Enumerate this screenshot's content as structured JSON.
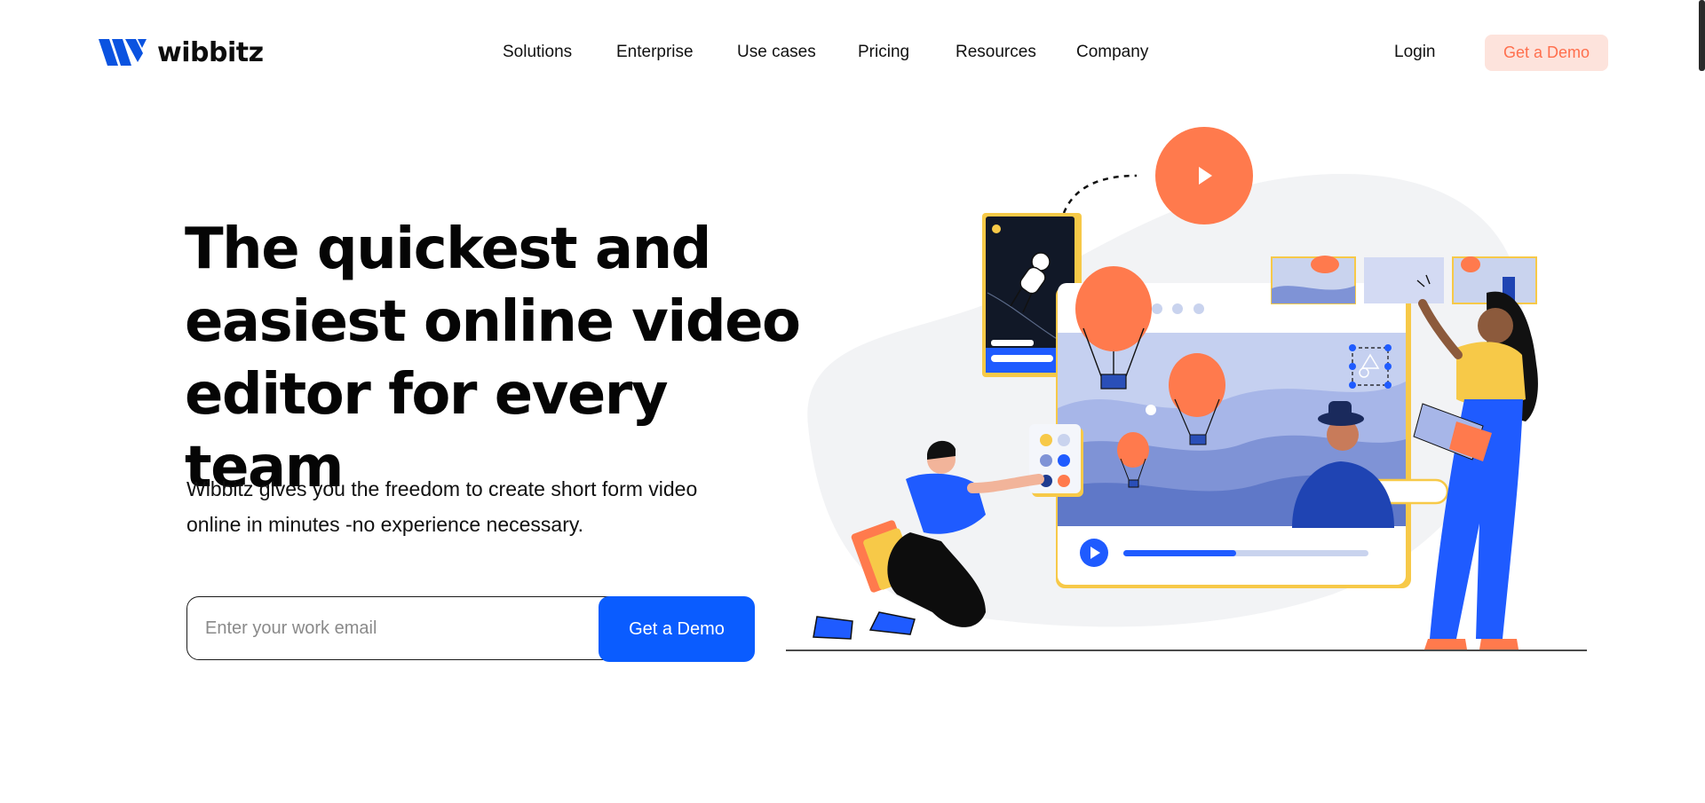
{
  "brand": {
    "name": "wibbitz"
  },
  "nav": {
    "items": [
      {
        "label": "Solutions"
      },
      {
        "label": "Enterprise"
      },
      {
        "label": "Use cases"
      },
      {
        "label": "Pricing"
      },
      {
        "label": "Resources"
      },
      {
        "label": "Company"
      }
    ],
    "login_label": "Login",
    "demo_label": "Get a Demo"
  },
  "hero": {
    "headline_lines": [
      "The quickest and",
      "easiest online video",
      "editor for every team"
    ],
    "subtext_lines": [
      "Wibbitz gives you the freedom to create short form video",
      "online in minutes -no experience necessary."
    ],
    "email_placeholder": "Enter your work email",
    "email_value": "",
    "cta_label": "Get a Demo"
  },
  "colors": {
    "brand_blue": "#0a5cff",
    "accent_orange": "#ff7a4d",
    "demo_pill_bg": "#fde3dc",
    "accent_yellow": "#f7c948"
  },
  "illustration": {
    "video_progress": 0.46,
    "icons": [
      "play-icon",
      "hot-air-balloon",
      "astronaut",
      "color-palette",
      "text-cursor-icon",
      "shape-tool-icon"
    ]
  }
}
